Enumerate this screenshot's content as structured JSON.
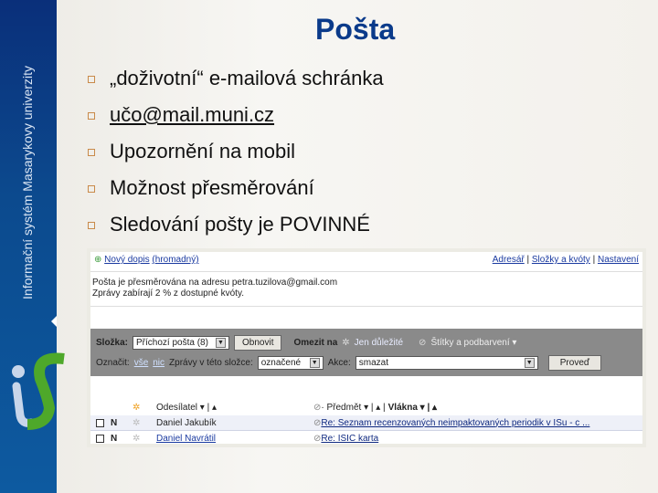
{
  "sidebar": {
    "vertical_text": "Informační systém Masarykovy univerzity"
  },
  "title": "Pošta",
  "bullets": [
    "„doživotní“ e-mailová schránka",
    "učo@mail.muni.cz",
    "Upozornění na mobil",
    "Možnost přesměrování",
    "Sledování pošty je POVINNÉ"
  ],
  "mail": {
    "new_message": "Nový dopis",
    "bulk": "(hromadný)",
    "top_links": [
      "Adresář",
      "Složky a kvóty",
      "Nastavení"
    ],
    "info1": "Pošta je přesměrována na adresu petra.tuzilova@gmail.com",
    "info2": "Zprávy zabírají 2 % z dostupné kvóty.",
    "folder_label": "Složka:",
    "folder_value": "Příchozí pošta (8)",
    "refresh": "Obnovit",
    "limit_label": "Omezit na",
    "important": "Jen důležité",
    "labels": "Štítky a podbarvení ▾",
    "mark_label": "Označit:",
    "mark_all": "vše",
    "mark_none": "nic",
    "messages_label": "Zprávy v této složce:",
    "messages_value": "označené",
    "action_label": "Akce:",
    "action_value": "smazat",
    "do": "Proveď",
    "col_sender": "Odesílatel ▾ | ▴",
    "col_subject": "· Předmět ▾ | ▴ |",
    "col_threads": "Vlákna ▾ | ▴",
    "rows": [
      {
        "flag": "N",
        "sender": "Daniel Jakubík",
        "subject": "Re: Seznam recenzovaných neimpaktovaných periodik v ISu - c ..."
      },
      {
        "flag": "N",
        "sender": "Daniel Navrátil",
        "subject": "Re: ISIC karta"
      }
    ]
  }
}
